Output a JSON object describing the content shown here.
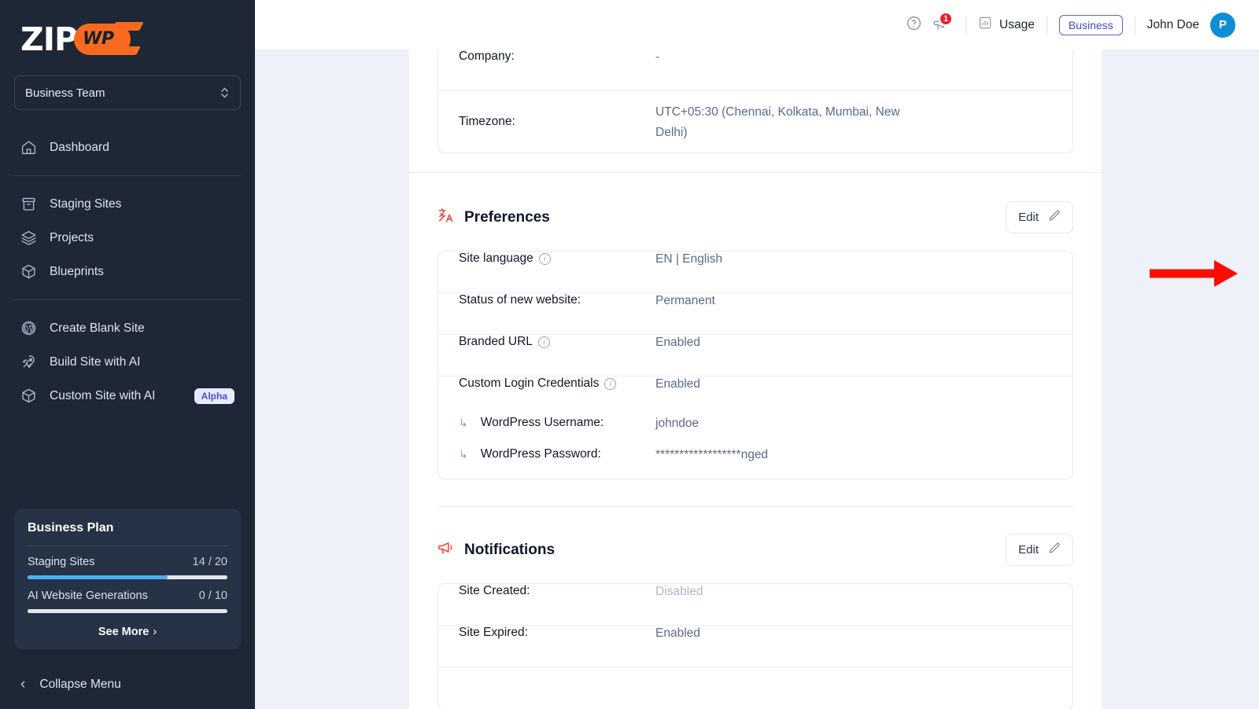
{
  "brand": {
    "name_zip": "ZIP",
    "name_wp": "WP",
    "orange": "#f96a20"
  },
  "sidebar": {
    "team_selector": {
      "label": "Business Team",
      "icon": "chevron-updown-icon"
    },
    "items": [
      {
        "label": "Dashboard",
        "icon": "home-icon"
      },
      {
        "label": "Staging Sites",
        "icon": "archive-icon"
      },
      {
        "label": "Projects",
        "icon": "layers-icon"
      },
      {
        "label": "Blueprints",
        "icon": "cube-icon"
      },
      {
        "label": "Create Blank Site",
        "icon": "wordpress-icon"
      },
      {
        "label": "Build Site with AI",
        "icon": "rocket-icon"
      },
      {
        "label": "Custom Site with AI",
        "icon": "cube-icon",
        "badge": "Alpha"
      }
    ],
    "plan": {
      "title": "Business Plan",
      "usage": [
        {
          "label": "Staging Sites",
          "value": "14 / 20",
          "percent": 70
        },
        {
          "label": "AI Website Generations",
          "value": "0 / 10",
          "percent": 0
        }
      ],
      "see_more": "See More",
      "see_more_icon": "chevron-right-icon",
      "bar_fill_color": "#4cb0ec"
    },
    "collapse": {
      "label": "Collapse Menu",
      "icon": "chevron-left-icon"
    }
  },
  "topbar": {
    "help_icon": "question-circle-icon",
    "announcement_icon": "megaphone-icon",
    "notification_count": "1",
    "usage": {
      "label": "Usage",
      "icon": "bar-chart-icon"
    },
    "plan_badge": "Business",
    "user_name": "John Doe",
    "avatar_initial": "P",
    "avatar_color": "#0c8fd4",
    "badge_color": "#ef1d2e"
  },
  "main": {
    "account_card": {
      "rows": [
        {
          "label": "Company:",
          "value": "-"
        },
        {
          "label": "Timezone:",
          "value": "UTC+05:30 (Chennai, Kolkata, Mumbai, New Delhi)"
        }
      ]
    },
    "preferences": {
      "title": "Preferences",
      "icon": "translate-icon",
      "icon_color": "#f04438",
      "edit_label": "Edit",
      "edit_icon": "pencil-icon",
      "rows": [
        {
          "label": "Site language",
          "info": true,
          "value": "EN | English",
          "dim": false
        },
        {
          "label": "Status of new website:",
          "info": false,
          "value": "Permanent",
          "dim": false
        },
        {
          "label": "Branded URL",
          "info": true,
          "value": "Enabled",
          "dim": false
        },
        {
          "label": "Custom Login Credentials",
          "info": true,
          "value": "Enabled",
          "dim": false
        },
        {
          "label": "WordPress Username:",
          "info": false,
          "value": "johndoe",
          "dim": false,
          "sub": true
        },
        {
          "label": "WordPress Password:",
          "info": false,
          "value": "******************nged",
          "dim": false,
          "sub": true
        }
      ]
    },
    "notifications": {
      "title": "Notifications",
      "icon": "megaphone-icon",
      "icon_color": "#f04438",
      "edit_label": "Edit",
      "edit_icon": "pencil-icon",
      "rows": [
        {
          "label": "Site Created:",
          "value": "Disabled",
          "dim": true
        },
        {
          "label": "Site Expired:",
          "value": "Enabled",
          "dim": false
        }
      ]
    },
    "annotation": {
      "type": "arrow",
      "color": "#fc0d00",
      "points_to": "preferences-edit-button"
    }
  }
}
